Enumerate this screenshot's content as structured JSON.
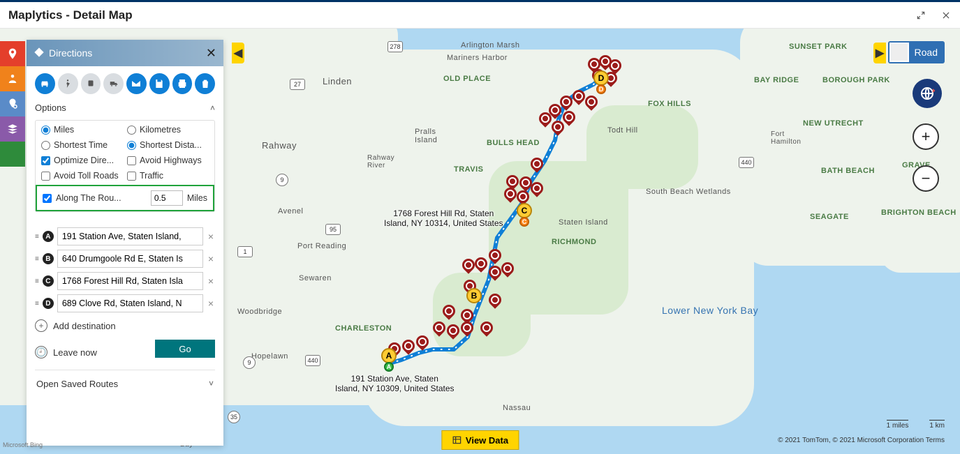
{
  "title": "Maplytics - Detail Map",
  "maptype_label": "Road",
  "panel": {
    "header": "Directions",
    "options_label": "Options",
    "units": {
      "miles": "Miles",
      "km": "Kilometres"
    },
    "criteria": {
      "time": "Shortest Time",
      "distance": "Shortest Dista..."
    },
    "toggles": {
      "optimize": "Optimize Dire...",
      "avoid_highways": "Avoid Highways",
      "avoid_tolls": "Avoid Toll Roads",
      "traffic": "Traffic",
      "along_route": "Along The Rou..."
    },
    "along_value": "0.5",
    "along_unit": "Miles",
    "options_state": {
      "unit": "miles",
      "criteria": "distance",
      "optimize": true,
      "avoid_highways": false,
      "avoid_tolls": false,
      "traffic": false,
      "along_route": true
    },
    "waypoints": [
      {
        "letter": "A",
        "address": "191 Station Ave, Staten Island,"
      },
      {
        "letter": "B",
        "address": "640 Drumgoole Rd E, Staten Is"
      },
      {
        "letter": "C",
        "address": "1768 Forest Hill Rd, Staten Isla"
      },
      {
        "letter": "D",
        "address": "689 Clove Rd, Staten Island, N"
      }
    ],
    "add_destination": "Add destination",
    "leave_now": "Leave now",
    "go": "Go",
    "saved_routes": "Open Saved Routes"
  },
  "map": {
    "callout_A_l1": "191 Station Ave, Staten",
    "callout_A_l2": "Island, NY 10309, United States",
    "callout_C_l1": "1768 Forest Hill Rd, Staten",
    "callout_C_l2": "Island, NY 10314, United States",
    "view_data": "View Data",
    "scale_miles": "1 miles",
    "scale_km": "1 km",
    "attrib": "© 2021 TomTom, © 2021 Microsoft Corporation   Terms",
    "bing": "Microsoft Bing",
    "bay_label": "Lower New York Bay",
    "labels": {
      "arlington_marsh": "Arlington Marsh",
      "mariners_harbor": "Mariners Harbor",
      "old_place": "OLD PLACE",
      "linden": "Linden",
      "pralls": "Pralls\nIsland",
      "bulls_head": "BULLS HEAD",
      "todt_hill": "Todt Hill",
      "fox_hills": "FOX HILLS",
      "rahway": "Rahway",
      "rahway_river": "Rahway\nRiver",
      "travis": "TRAVIS",
      "avenel": "Avenel",
      "port_reading": "Port Reading",
      "sewaren": "Sewaren",
      "staten_island": "Staten Island",
      "richmond": "RICHMOND",
      "south_beach": "South Beach Wetlands",
      "charleston": "CHARLESTON",
      "hopelawn": "Hopelawn",
      "nassau": "Nassau",
      "raritan_bay": "Raritan\nBay",
      "sunset_park": "SUNSET PARK",
      "bay_ridge": "BAY RIDGE",
      "borough_park": "BOROUGH PARK",
      "new_utrecht": "NEW UTRECHT",
      "fort_hamilton": "Fort\nHamilton",
      "bath_beach": "BATH BEACH",
      "grave": "GRAVE",
      "seagate": "SEAGATE",
      "brighton_beach": "BRIGHTON BEACH",
      "woodbridge": "Woodbridge"
    }
  },
  "route": {
    "stops": [
      "A",
      "B",
      "C",
      "D"
    ],
    "along_route_radius_miles": 0.5
  }
}
